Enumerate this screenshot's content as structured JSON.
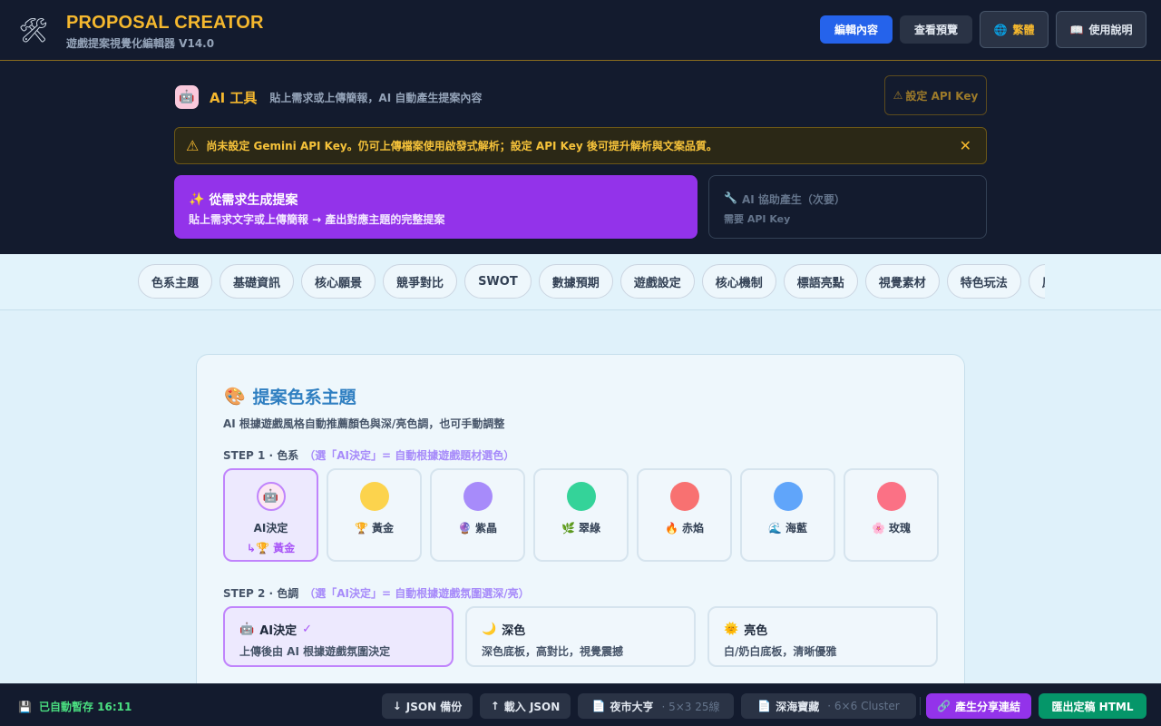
{
  "header": {
    "title": "PROPOSAL CREATOR",
    "subtitle": "遊戲提案視覺化編輯器 V14.0",
    "edit_label": "編輯內容",
    "preview_label": "查看預覽",
    "lang_label": "繁體",
    "help_label": "使用說明",
    "accent": "#f5b82e"
  },
  "ai_tool": {
    "title": "AI 工具",
    "desc": "貼上需求或上傳簡報，AI 自動產生提案內容",
    "api_key_label": "設定 API Key",
    "warning": "尚未設定 Gemini API Key。仍可上傳檔案使用啟發式解析；設定 API Key 後可提升解析與文案品質。",
    "generate_title": "從需求生成提案",
    "generate_sub": "貼上需求文字或上傳簡報 → 產出對應主題的完整提案",
    "assist_title": "AI 協助產生（次要）",
    "assist_sub": "需要 API Key"
  },
  "tabs": [
    "色系主題",
    "基礎資訊",
    "核心願景",
    "競爭對比",
    "SWOT",
    "數據預期",
    "遊戲設定",
    "核心機制",
    "標語亮點",
    "視覺素材",
    "特色玩法",
    "風格"
  ],
  "theme": {
    "title": "提案色系主題",
    "desc": "AI 根據遊戲風格自動推薦顏色與深/亮色調，也可手動調整",
    "step1_label": "STEP 1 · 色系",
    "step1_hint": "（選「AI決定」= 自動根據遊戲題材選色）",
    "step2_label": "STEP 2 · 色調",
    "step2_hint": "（選「AI決定」= 自動根據遊戲氛圍選深/亮）",
    "swatches": [
      {
        "label": "AI決定",
        "sub": "↳🏆 黃金",
        "emoji": "",
        "color": "#fce7f3"
      },
      {
        "label": "黃金",
        "emoji": "🏆",
        "color": "#fcd34d"
      },
      {
        "label": "紫晶",
        "emoji": "🔮",
        "color": "#a78bfa"
      },
      {
        "label": "翠綠",
        "emoji": "🌿",
        "color": "#34d399"
      },
      {
        "label": "赤焰",
        "emoji": "🔥",
        "color": "#f87171"
      },
      {
        "label": "海藍",
        "emoji": "🌊",
        "color": "#60a5fa"
      },
      {
        "label": "玫瑰",
        "emoji": "🌸",
        "color": "#fb7185"
      }
    ],
    "tones": [
      {
        "label": "AI決定",
        "check": "✓",
        "emoji": "🤖",
        "sub": "上傳後由 AI 根據遊戲氛圍決定"
      },
      {
        "label": "深色",
        "emoji": "🌙",
        "sub": "深色底板，高對比，視覺震撼"
      },
      {
        "label": "亮色",
        "emoji": "🌞",
        "sub": "白/奶白底板，清晰優雅"
      }
    ]
  },
  "footer": {
    "saved": "已自動暫存 16:11",
    "json_backup": "JSON 備份",
    "load_json": "載入 JSON",
    "night_market": "夜市大亨",
    "night_meta": "· 5×3 25線",
    "deep_sea": "深海寶藏",
    "deep_meta": "· 6×6 Cluster",
    "share": "產生分享連結",
    "export": "匯出定稿 HTML"
  }
}
